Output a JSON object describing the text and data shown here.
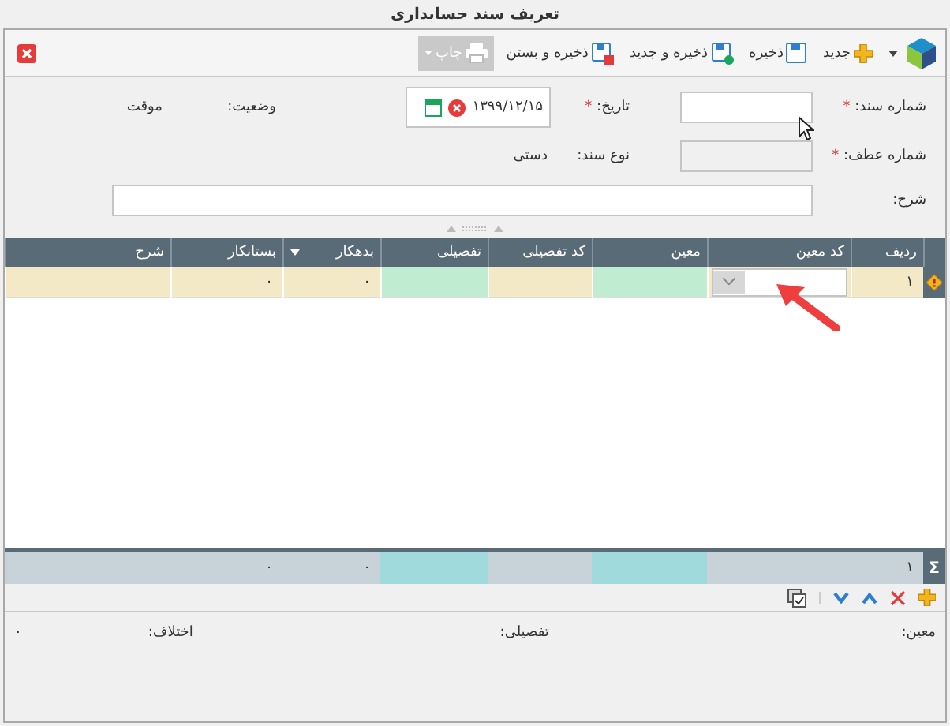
{
  "window": {
    "title": "تعریف سند حسابداری"
  },
  "toolbar": [
    {
      "kind": "new",
      "label": "جدید",
      "disabled": false
    },
    {
      "kind": "save",
      "label": "ذخیره",
      "disabled": false
    },
    {
      "kind": "save_new",
      "label": "ذخیره و جدید",
      "disabled": false
    },
    {
      "kind": "save_close",
      "label": "ذخیره و بستن",
      "disabled": false
    },
    {
      "kind": "print",
      "label": "چاپ",
      "disabled": true
    }
  ],
  "form": {
    "doc_number": {
      "label": "شماره سند:",
      "mark": "*",
      "disabled": false
    },
    "date": {
      "label": "تاریخ:",
      "mark": "*",
      "value": "۱۳۹۹/۱۲/۱۵"
    },
    "status": {
      "label": "وضعیت:",
      "value": "موقت"
    },
    "ref_number": {
      "label": "شماره عطف:",
      "mark": "*",
      "disabled": true
    },
    "doc_type": {
      "label": "نوع سند:",
      "value": "دستی"
    },
    "description": {
      "label": "شرح:"
    }
  },
  "grid": {
    "columns": [
      {
        "label": "ردیف",
        "menu": false
      },
      {
        "label": "کد معین",
        "menu": false
      },
      {
        "label": "معین",
        "menu": false
      },
      {
        "label": "کد تفصیلی",
        "menu": false
      },
      {
        "label": "تفصیلی",
        "menu": false
      },
      {
        "label": "بدهکار",
        "menu": true
      },
      {
        "label": "بستانکار",
        "menu": false
      },
      {
        "label": "شرح",
        "menu": false
      }
    ],
    "rows": [
      {
        "selected": true,
        "cells": [
          {
            "kind": "text",
            "value": "۱",
            "color": "#f3e9c6"
          },
          {
            "kind": "dropdown",
            "color": "#f3e9c6"
          },
          {
            "kind": "text",
            "color": "#c0ecd2"
          },
          {
            "kind": "text",
            "color": "#f3e9c6"
          },
          {
            "kind": "text",
            "color": "#c0ecd2"
          },
          {
            "kind": "text",
            "value": "۰",
            "color": "#f3e9c6"
          },
          {
            "kind": "text",
            "value": "۰",
            "color": "#f3e9c6"
          },
          {
            "kind": "text",
            "color": "#f3e9c6"
          }
        ]
      }
    ],
    "totals": {
      "symbol": "Σ",
      "cells": [
        {
          "value": "۱",
          "color": "#c8d3d9"
        },
        {
          "color": "#c8d3d9"
        },
        {
          "color": "#a0dadd"
        },
        {
          "color": "#c8d3d9"
        },
        {
          "color": "#a0dadd"
        },
        {
          "value": "۰",
          "color": "#c8d3d9"
        },
        {
          "value": "۰",
          "color": "#c8d3d9"
        },
        {
          "color": "#c8d3d9"
        }
      ]
    }
  },
  "summary": [
    {
      "label": "معین:"
    },
    {
      "label": "تفصیلی:"
    },
    {
      "label": "اختلاف:",
      "value": "۰"
    }
  ]
}
